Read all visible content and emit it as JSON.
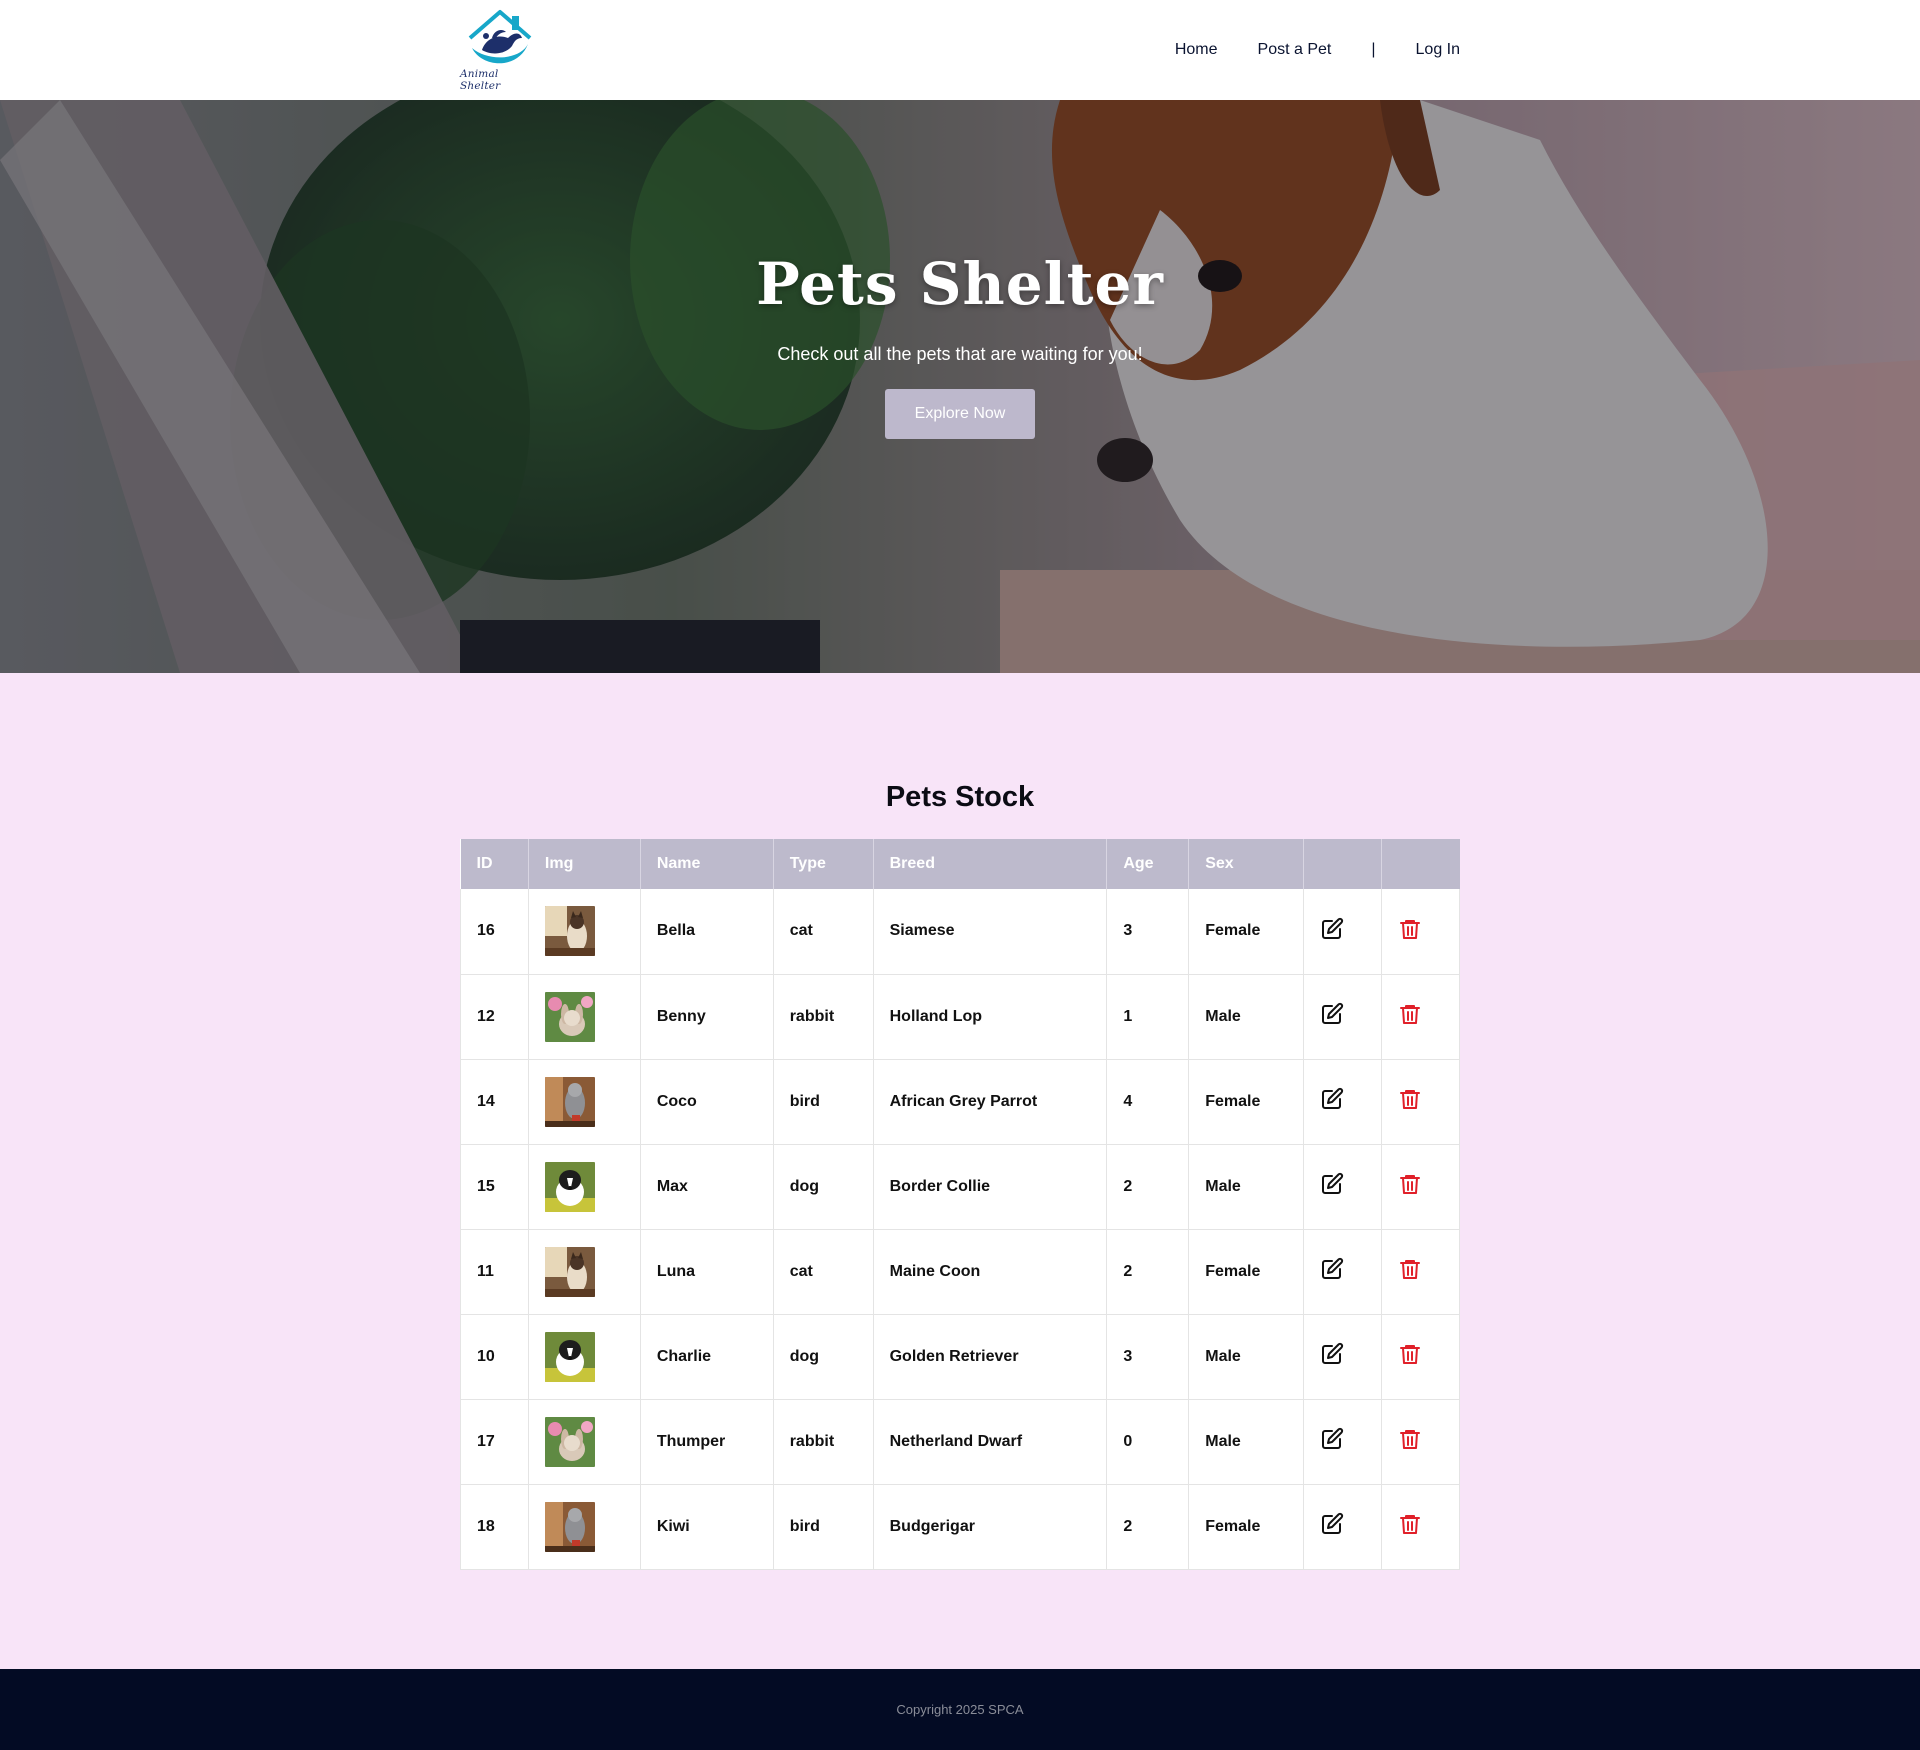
{
  "brand": {
    "logo_text": "Animal Shelter"
  },
  "nav": {
    "home": "Home",
    "post": "Post a Pet",
    "separator": "|",
    "login": "Log In"
  },
  "hero": {
    "title": "Pets Shelter",
    "subtitle": "Check out all the pets that are waiting for you!",
    "button": "Explore Now"
  },
  "stock": {
    "title": "Pets Stock",
    "headers": [
      "ID",
      "Img",
      "Name",
      "Type",
      "Breed",
      "Age",
      "Sex",
      "",
      ""
    ],
    "rows": [
      {
        "id": "16",
        "name": "Bella",
        "type": "cat",
        "breed": "Siamese",
        "age": "3",
        "sex": "Female",
        "img": "cat-photo"
      },
      {
        "id": "12",
        "name": "Benny",
        "type": "rabbit",
        "breed": "Holland Lop",
        "age": "1",
        "sex": "Male",
        "img": "rabbit-photo"
      },
      {
        "id": "14",
        "name": "Coco",
        "type": "bird",
        "breed": "African Grey Parrot",
        "age": "4",
        "sex": "Female",
        "img": "bird-photo"
      },
      {
        "id": "15",
        "name": "Max",
        "type": "dog",
        "breed": "Border Collie",
        "age": "2",
        "sex": "Male",
        "img": "dog-photo"
      },
      {
        "id": "11",
        "name": "Luna",
        "type": "cat",
        "breed": "Maine Coon",
        "age": "2",
        "sex": "Female",
        "img": "cat-photo"
      },
      {
        "id": "10",
        "name": "Charlie",
        "type": "dog",
        "breed": "Golden Retriever",
        "age": "3",
        "sex": "Male",
        "img": "dog-photo"
      },
      {
        "id": "17",
        "name": "Thumper",
        "type": "rabbit",
        "breed": "Netherland Dwarf",
        "age": "0",
        "sex": "Male",
        "img": "rabbit-photo"
      },
      {
        "id": "18",
        "name": "Kiwi",
        "type": "bird",
        "breed": "Budgerigar",
        "age": "2",
        "sex": "Female",
        "img": "bird-photo"
      }
    ],
    "edit_icon": "edit-icon",
    "delete_icon": "trash-icon"
  },
  "footer": {
    "copyright": "Copyright 2025 SPCA"
  },
  "colors": {
    "page_bg": "#f8e4f8",
    "table_header": "#bdbacc",
    "delete": "#e0202a",
    "footer_bg": "#030b24",
    "hero_button": "#bdb8cc"
  }
}
